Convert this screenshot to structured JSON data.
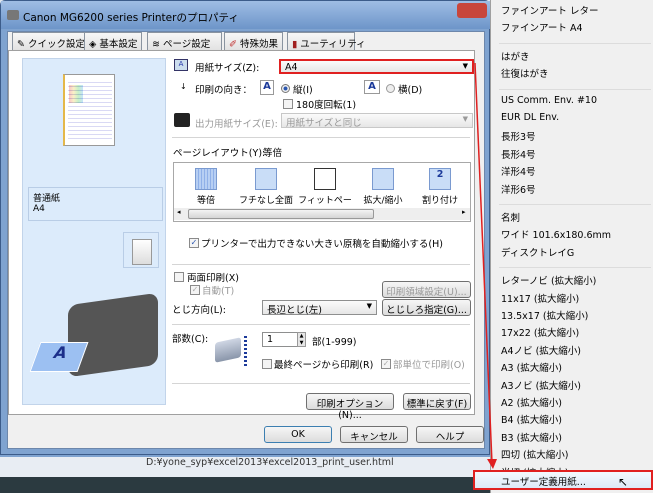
{
  "window": {
    "title": "Canon MG6200 series Printerのプロパティ"
  },
  "tabs": [
    {
      "label": "クイック設定"
    },
    {
      "label": "基本設定"
    },
    {
      "label": "ページ設定"
    },
    {
      "label": "特殊効果"
    },
    {
      "label": "ユーティリティ"
    }
  ],
  "preview": {
    "media": "普通紙",
    "size": "A4"
  },
  "page_setup": {
    "paper_size_label": "用紙サイズ(Z):",
    "paper_size_value": "A4",
    "orientation_label": "印刷の向き：",
    "portrait_label": "縦(I)",
    "landscape_label": "横(D)",
    "rotate_label": "180度回転(1)",
    "output_size_label": "出力用紙サイズ(E):",
    "output_size_value": "用紙サイズと同じ",
    "layout_label": "ページレイアウト(Y):",
    "layout_value": "等倍",
    "layouts": [
      {
        "label": "等倍"
      },
      {
        "label": "フチなし全面"
      },
      {
        "label": "フィットページ"
      },
      {
        "label": "拡大/縮小"
      },
      {
        "label": "割り付け"
      }
    ],
    "auto_reduce_label": "プリンターで出力できない大きい原稿を自動縮小する(H)",
    "duplex_label": "両面印刷(X)",
    "auto_label": "自動(T)",
    "print_area_button": "印刷領域設定(U)...",
    "binding_label": "とじ方向(L):",
    "binding_value": "長辺とじ(左)",
    "margin_button": "とじしろ指定(G)...",
    "copies_label": "部数(C):",
    "copies_value": "1",
    "copies_range": "部(1-999)",
    "reverse_label": "最終ページから印刷(R)",
    "collate_label": "部単位で印刷(O)",
    "options_button": "印刷オプション(N)...",
    "defaults_button": "標準に戻す(F)"
  },
  "buttons": {
    "ok": "OK",
    "cancel": "キャンセル",
    "help": "ヘルプ"
  },
  "status_path": "D:¥yone_syp¥excel2013¥excel2013_print_user.html",
  "menu": {
    "groups": [
      [
        "ファインアート レター",
        "ファインアート A4"
      ],
      [
        "はがき",
        "往復はがき"
      ],
      [
        "US Comm. Env. #10",
        "EUR DL Env.",
        "長形3号",
        "長形4号",
        "洋形4号",
        "洋形6号"
      ],
      [
        "名刺",
        "ワイド 101.6x180.6mm",
        "ディスクトレイG"
      ],
      [
        "レターノビ (拡大縮小)",
        "11x17 (拡大縮小)",
        "13.5x17 (拡大縮小)",
        "17x22 (拡大縮小)",
        "A4ノビ (拡大縮小)",
        "A3 (拡大縮小)",
        "A3ノビ (拡大縮小)",
        "A2 (拡大縮小)",
        "B4 (拡大縮小)",
        "B3 (拡大縮小)",
        "四切 (拡大縮小)",
        "半切 (拡大縮小)"
      ]
    ],
    "selected": "ユーザー定義用紙..."
  },
  "colors": {
    "highlight": "#e02020",
    "accent": "#2a56b0"
  }
}
